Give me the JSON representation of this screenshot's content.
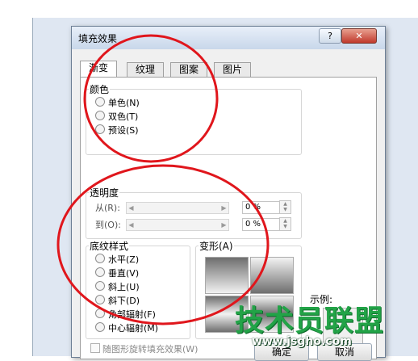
{
  "dialog": {
    "title": "填充效果",
    "help_label": "?",
    "close_label": "✕"
  },
  "tabs": [
    {
      "label": "渐变"
    },
    {
      "label": "纹理"
    },
    {
      "label": "图案"
    },
    {
      "label": "图片"
    }
  ],
  "colors_group": {
    "label": "颜色",
    "options": [
      {
        "label": "单色(N)"
      },
      {
        "label": "双色(T)"
      },
      {
        "label": "预设(S)"
      }
    ]
  },
  "transparency_group": {
    "label": "透明度",
    "from_label": "从(R):",
    "to_label": "到(O):",
    "from_value": "0 %",
    "to_value": "0 %"
  },
  "shading_group": {
    "label": "底纹样式",
    "options": [
      {
        "label": "水平(Z)"
      },
      {
        "label": "垂直(V)"
      },
      {
        "label": "斜上(U)"
      },
      {
        "label": "斜下(D)"
      },
      {
        "label": "角部辐射(F)"
      },
      {
        "label": "中心辐射(M)"
      }
    ]
  },
  "variants_group": {
    "label": "变形(A)"
  },
  "sample_label": "示例:",
  "rotate_checkbox_label": "随图形旋转填充效果(W)",
  "buttons": {
    "ok": "确定",
    "cancel": "取消"
  },
  "watermark": {
    "text": "技术员联盟",
    "url": "www.jsgho.com"
  },
  "annotation_color": "#e0161c"
}
